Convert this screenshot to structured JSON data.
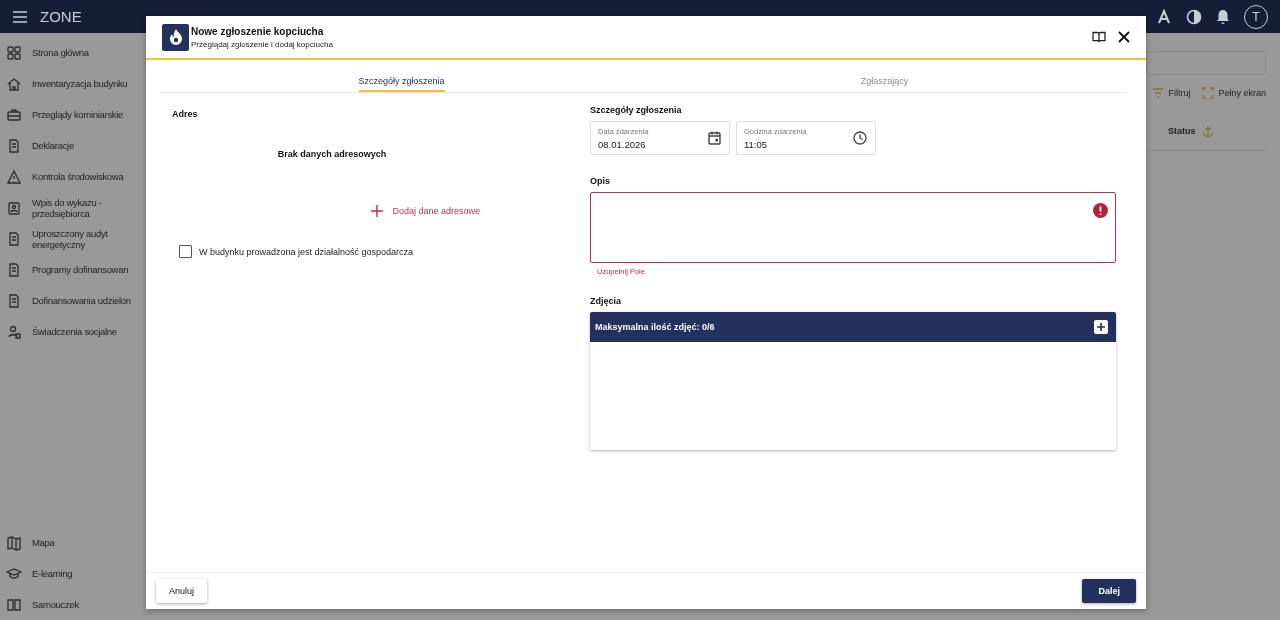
{
  "top_bar": {
    "title": "ZONE",
    "avatar": "T"
  },
  "sidebar": {
    "items": [
      {
        "label": "Strona główna"
      },
      {
        "label": "Inwentaryzacja budynku"
      },
      {
        "label": "Przeglądy kominiarskie"
      },
      {
        "label": "Deklaracje"
      },
      {
        "label": "Kontrola środowiskowa"
      },
      {
        "label": "Wpis do wykazu - przedsiębiorca"
      },
      {
        "label": "Uproszczony audyt energetyczny"
      },
      {
        "label": "Programy dofinansowan"
      },
      {
        "label": "Dofinansowania udzielon"
      },
      {
        "label": "Świadczenia socjalne"
      }
    ],
    "bottom_items": [
      {
        "label": "Mapa"
      },
      {
        "label": "E-learning"
      },
      {
        "label": "Samouczek"
      }
    ]
  },
  "background": {
    "actions": [
      {
        "label": "Filtruj"
      },
      {
        "label": "Pełny ekran"
      }
    ],
    "column": "Status"
  },
  "dialog": {
    "title": "Nowe zgłoszenie kopciucha",
    "subtitle": "Przeglądaj zgłoszenie i dodaj kopciucha",
    "tabs": [
      {
        "label": "Szczegóły zgłoszenia",
        "selected": true
      },
      {
        "label": "Zgłaszający",
        "selected": false
      }
    ],
    "address": {
      "heading": "Adres",
      "empty": "Brak danych adresowych",
      "add_link": "Dodaj dane adresowe",
      "checkbox": {
        "label": "W budynku prowadzona jest działalność gospodarcza",
        "checked": false
      }
    },
    "details": {
      "heading": "Szczegóły zgłoszenia",
      "fields": [
        {
          "label": "Data zdarzenia",
          "value": "08.01.2026",
          "kind": "date"
        },
        {
          "label": "Godzina zdarzenia",
          "value": "11:05",
          "kind": "time"
        }
      ]
    },
    "description": {
      "label": "Opis",
      "invalid": true,
      "error_text": "Uzupełnij Pole"
    },
    "photos": {
      "label": "Zdjęcia",
      "header": "Maksymalna ilość zdjęć: 0/6"
    },
    "buttons": [
      {
        "label": "Anuluj",
        "kind": "secondary"
      },
      {
        "label": "Dalej",
        "kind": "primary"
      }
    ]
  }
}
